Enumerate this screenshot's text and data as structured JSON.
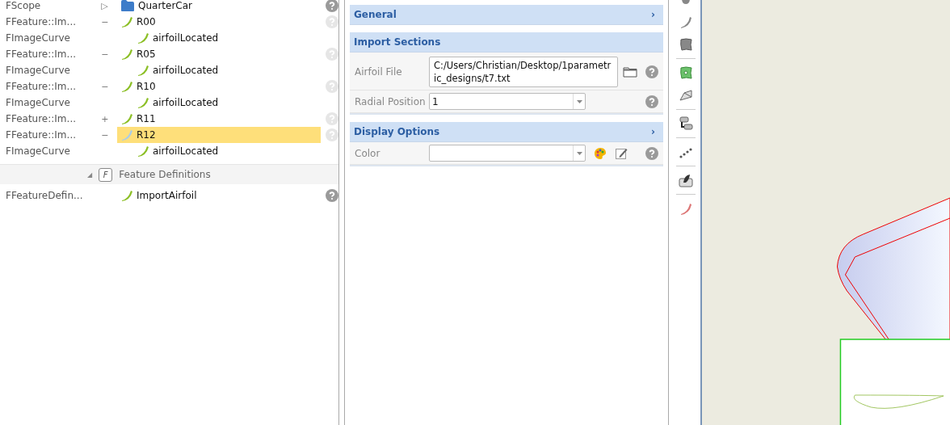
{
  "tree": {
    "rows": [
      {
        "type": "FScope",
        "toggle": "▷",
        "kind": "folder",
        "label": "QuarterCar",
        "selected": false,
        "help_active": true
      },
      {
        "type": "FFeature::Im...",
        "toggle": "−",
        "kind": "feature",
        "label": "R00",
        "selected": false,
        "help_active": false,
        "children": [
          {
            "type": "FImageCurve",
            "kind": "feature",
            "label": "airfoilLocated"
          }
        ]
      },
      {
        "type": "FFeature::Im...",
        "toggle": "−",
        "kind": "feature",
        "label": "R05",
        "selected": false,
        "help_active": false,
        "children": [
          {
            "type": "FImageCurve",
            "kind": "feature",
            "label": "airfoilLocated"
          }
        ]
      },
      {
        "type": "FFeature::Im...",
        "toggle": "−",
        "kind": "feature",
        "label": "R10",
        "selected": false,
        "help_active": false,
        "children": [
          {
            "type": "FImageCurve",
            "kind": "feature",
            "label": "airfoilLocated"
          }
        ]
      },
      {
        "type": "FFeature::Im...",
        "toggle": "+",
        "kind": "feature",
        "label": "R11",
        "selected": false,
        "help_active": false
      },
      {
        "type": "FFeature::Im...",
        "toggle": "−",
        "kind": "feature",
        "label": "R12",
        "selected": true,
        "help_active": false,
        "children": [
          {
            "type": "FImageCurve",
            "kind": "feature",
            "label": "airfoilLocated"
          }
        ]
      }
    ],
    "group": {
      "toggle": "◢",
      "badge": "F",
      "title": "Feature Definitions",
      "rows": [
        {
          "type": "FFeatureDefin...",
          "kind": "feature",
          "label": "ImportAirfoil",
          "selected": false,
          "help_active": true
        }
      ]
    }
  },
  "properties": {
    "sections": [
      {
        "title": "General",
        "chevron": "›"
      },
      {
        "title": "Import Sections",
        "rows": [
          {
            "kind": "file",
            "label": "Airfoil File",
            "value": "C:/Users/Christian/Desktop/1parametric_designs/t7.txt"
          },
          {
            "kind": "combo",
            "label": "Radial Position",
            "value": "1"
          }
        ]
      },
      {
        "title": "Display Options",
        "chevron": "›",
        "rows": [
          {
            "kind": "color",
            "label": "Color"
          }
        ]
      }
    ]
  }
}
